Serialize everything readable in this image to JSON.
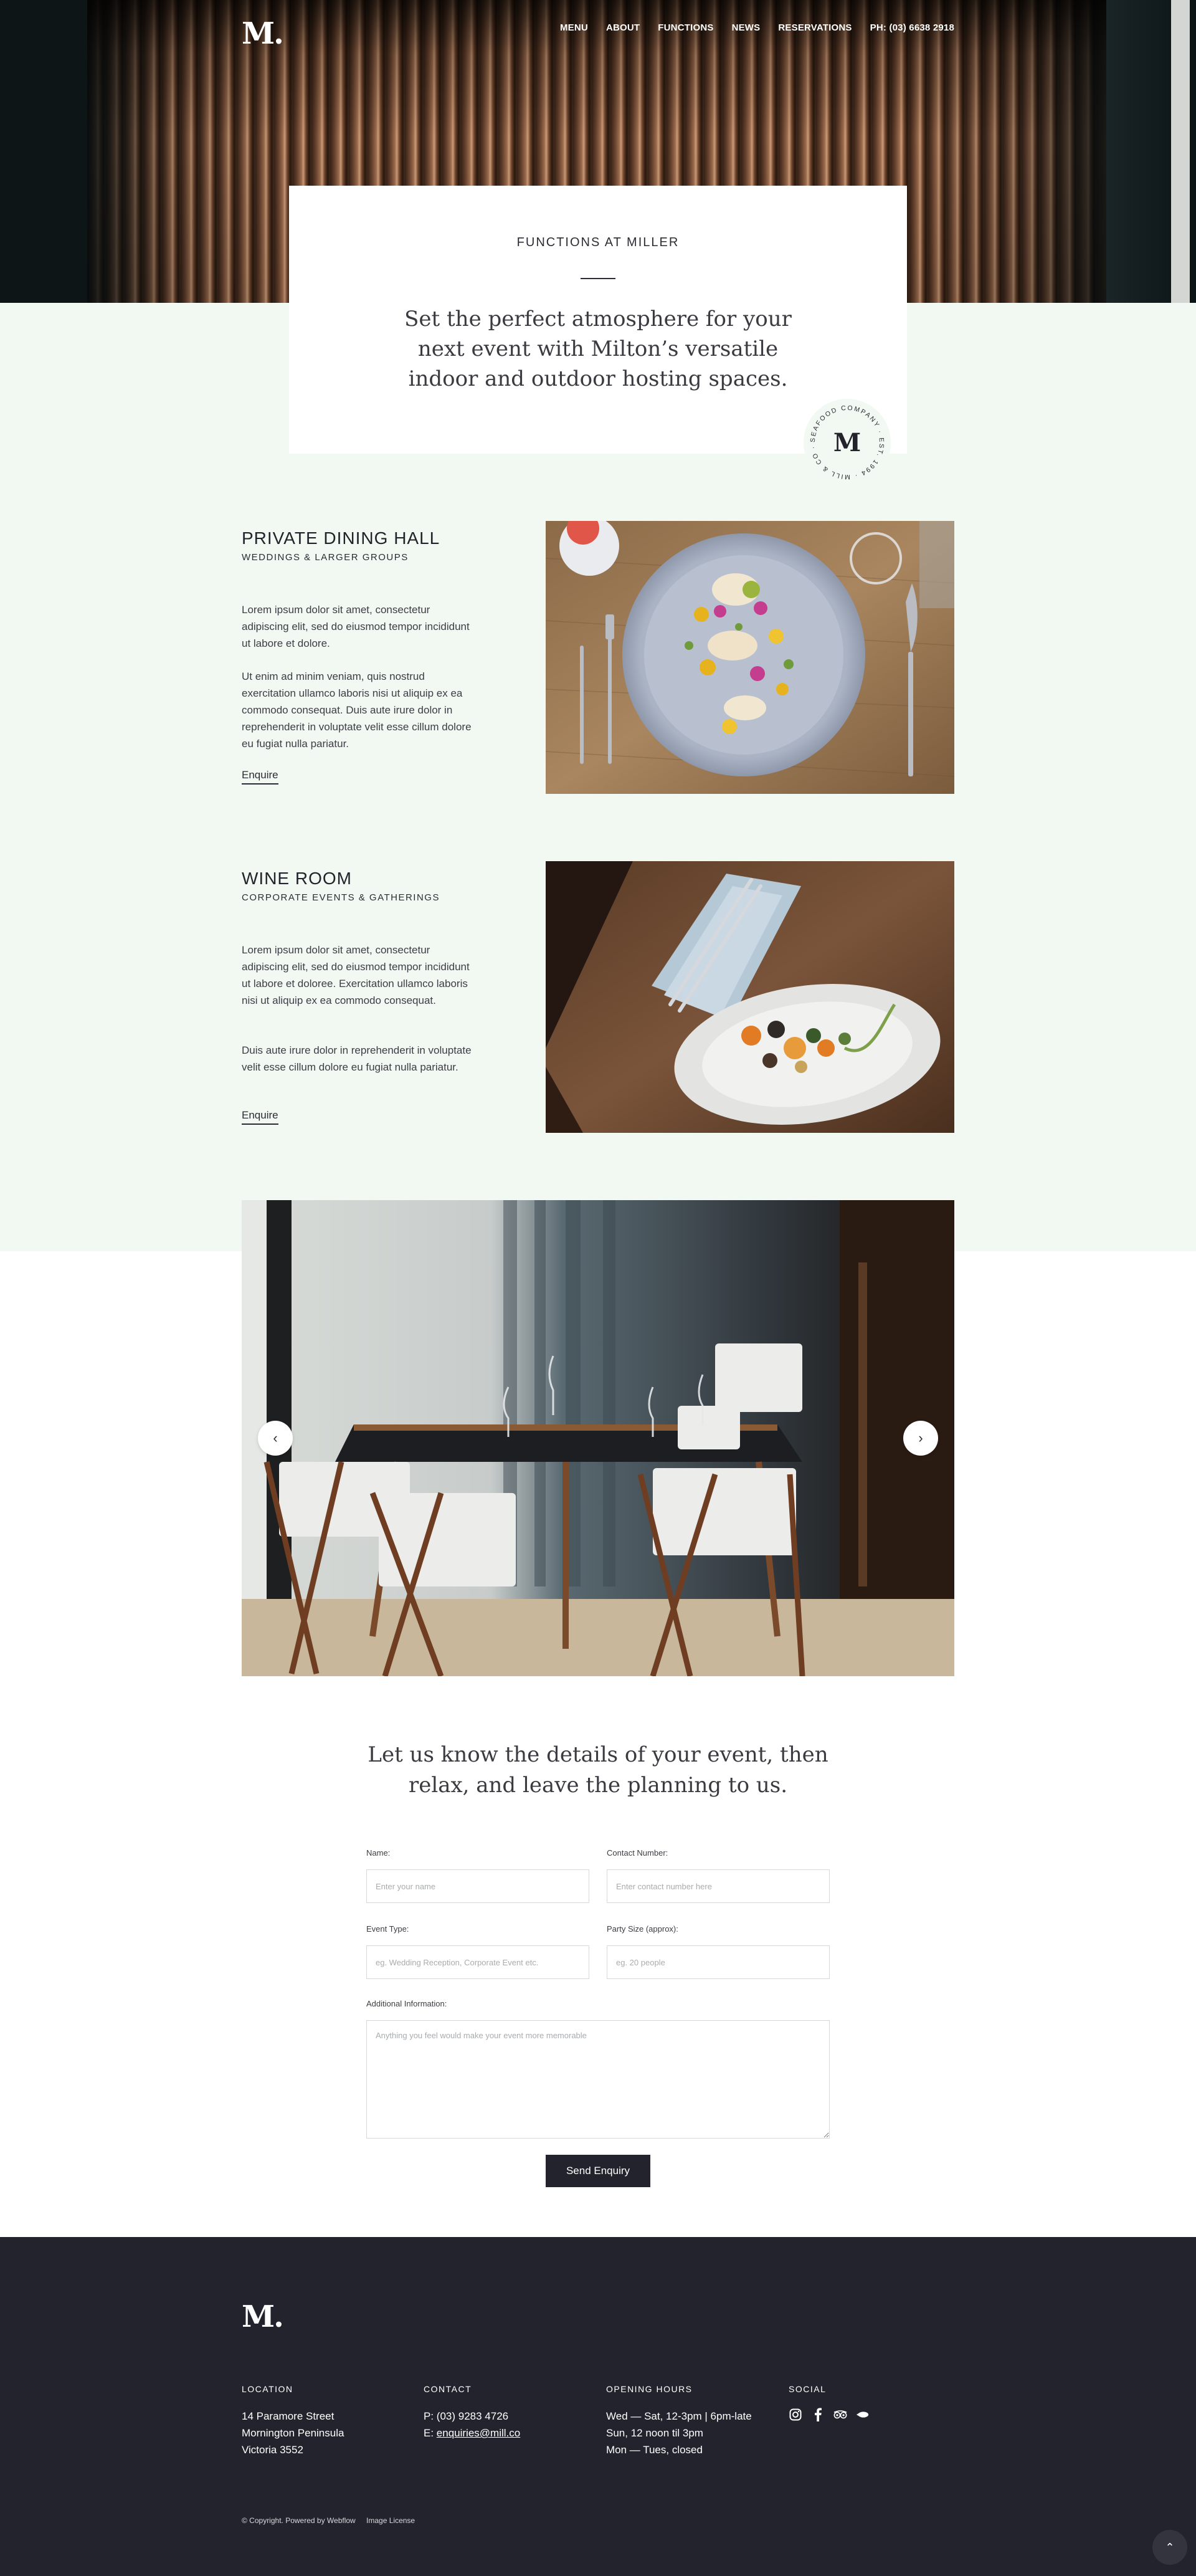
{
  "brand": {
    "logo": "M."
  },
  "nav": {
    "items": [
      "MENU",
      "ABOUT",
      "FUNCTIONS",
      "NEWS",
      "RESERVATIONS"
    ],
    "phone": "PH: (03) 6638 2918"
  },
  "intro": {
    "eyebrow": "FUNCTIONS AT MILLER",
    "text": "Set the perfect atmosphere for your next event with Milton’s versatile indoor and outdoor hosting spaces.",
    "stamp_text": "SEAFOOD COMPANY · EST. 1994 · MILL & CO ·",
    "stamp_letter": "M"
  },
  "sections": [
    {
      "title": "PRIVATE DINING HALL",
      "subtitle": "WEDDINGS & LARGER GROUPS",
      "para1": "Lorem ipsum dolor sit amet, consectetur adipiscing elit, sed do eiusmod tempor incididunt ut labore et dolore.",
      "para2": "Ut enim ad minim veniam, quis nostrud exercitation ullamco laboris nisi ut aliquip ex ea commodo consequat. Duis aute irure dolor in reprehenderit in voluptate velit esse cillum dolore eu fugiat nulla pariatur.",
      "link": "Enquire"
    },
    {
      "title": "WINE ROOM",
      "subtitle": "CORPORATE EVENTS & GATHERINGS",
      "para1": "Lorem ipsum dolor sit amet, consectetur adipiscing elit, sed do eiusmod tempor incididunt ut labore et doloree. Exercitation ullamco laboris nisi ut aliquip ex ea commodo consequat.",
      "para2": "Duis aute irure dolor in reprehenderit in voluptate velit esse cillum dolore eu fugiat nulla pariatur.",
      "link": "Enquire"
    }
  ],
  "slider": {
    "prev": "‹",
    "next": "›"
  },
  "form": {
    "heading": "Let us know the details of your event, then relax, and leave the planning to us.",
    "name_label": "Name:",
    "name_placeholder": "Enter your name",
    "contact_label": "Contact Number:",
    "contact_placeholder": "Enter contact number here",
    "event_label": "Event Type:",
    "event_placeholder": "eg. Wedding Reception, Corporate Event etc.",
    "party_label": "Party Size (approx):",
    "party_placeholder": "eg. 20 people",
    "info_label": "Additional Information:",
    "info_placeholder": "Anything you feel would make your event more memorable",
    "submit": "Send Enquiry"
  },
  "footer": {
    "logo": "M.",
    "location": {
      "heading": "LOCATION",
      "line1": "14 Paramore Street",
      "line2": "Mornington Peninsula",
      "line3": "Victoria 3552"
    },
    "contact": {
      "heading": "CONTACT",
      "phone": "P: (03) 9283 4726",
      "email_prefix": "E: ",
      "email": "enquiries@mill.co"
    },
    "hours": {
      "heading": "OPENING HOURS",
      "line1": "Wed — Sat, 12-3pm | 6pm-late",
      "line2": "Sun, 12 noon til 3pm",
      "line3": "Mon — Tues, closed"
    },
    "social": {
      "heading": "SOCIAL",
      "icons": [
        "instagram-icon",
        "facebook-icon",
        "tripadvisor-icon",
        "zomato-icon"
      ]
    },
    "copyright": "© Copyright. Powered by Webflow",
    "license": "Image License",
    "top": "⌃"
  },
  "colors": {
    "dark": "#23232e",
    "mint": "#f2f8f2",
    "white": "#ffffff"
  }
}
